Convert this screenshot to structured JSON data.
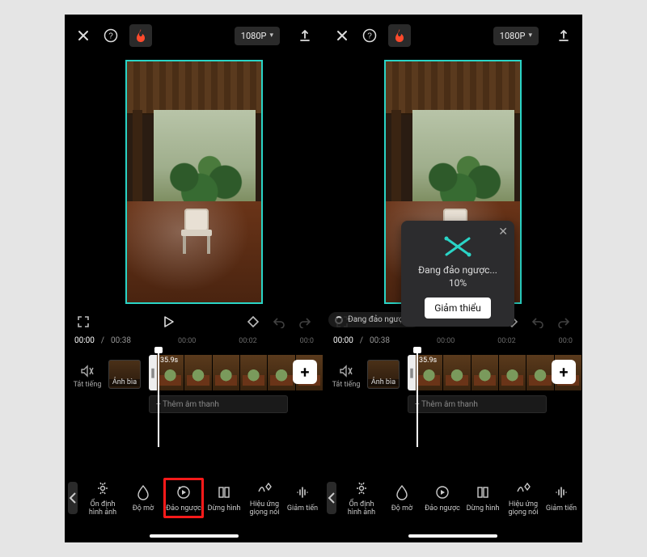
{
  "topbar": {
    "resolution": "1080P"
  },
  "player": {
    "currentTime": "00:00",
    "duration": "00:38",
    "ticks": [
      "00:00",
      "00:02",
      "00:0"
    ]
  },
  "timeline": {
    "muteLabel": "Tắt tiếng",
    "coverLabel": "Ảnh bìa",
    "clipDuration": "35.9s",
    "addAudio": "+  Thêm âm thanh"
  },
  "tools": {
    "items": [
      {
        "name": "stabilize",
        "label": "Ổn định hình ảnh"
      },
      {
        "name": "opacity",
        "label": "Độ mờ"
      },
      {
        "name": "reverse",
        "label": "Đảo ngược"
      },
      {
        "name": "freeze",
        "label": "Dừng hình"
      },
      {
        "name": "voicefx",
        "label": "Hiệu ứng giọng nói"
      },
      {
        "name": "reducenoise",
        "label": "Giảm tiến"
      }
    ]
  },
  "modal": {
    "text": "Đang đảo ngược... 10%",
    "button": "Giảm thiểu"
  },
  "toast": "Đang đảo ngược..."
}
